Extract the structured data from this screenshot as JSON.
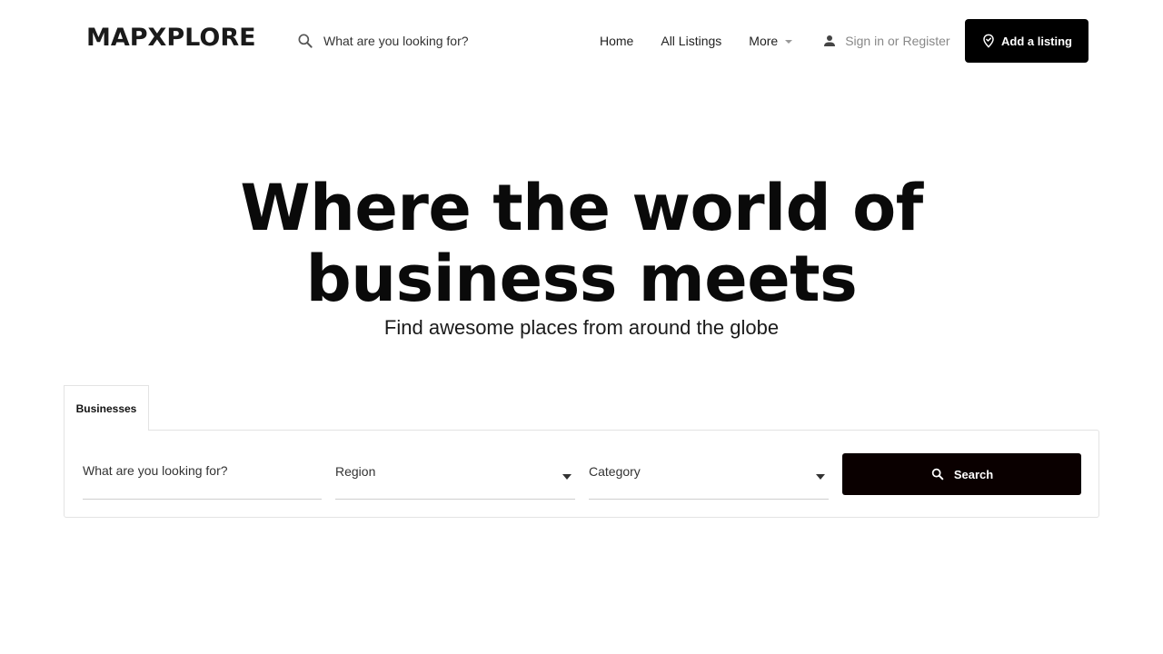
{
  "header": {
    "logo": "MAPXPLORE",
    "search_placeholder": "What are you looking for?",
    "nav": {
      "home": "Home",
      "all_listings": "All Listings",
      "more": "More"
    },
    "auth": {
      "sign_in": "Sign in",
      "or": "or",
      "register": "Register"
    },
    "add_listing": "Add a listing"
  },
  "hero": {
    "title_line1": "Where the world of",
    "title_line2": "business meets",
    "subtitle": "Find awesome places from around the globe"
  },
  "search_panel": {
    "tab": "Businesses",
    "keyword_placeholder": "What are you looking for?",
    "region_label": "Region",
    "category_label": "Category",
    "search_button": "Search"
  },
  "icons": {
    "header_search": "search-icon",
    "user": "user-icon",
    "add_listing": "map-pin-icon",
    "search_button": "search-icon"
  },
  "colors": {
    "primary_button": "#000000",
    "search_button": "#0a0000",
    "muted_text": "#888888"
  }
}
